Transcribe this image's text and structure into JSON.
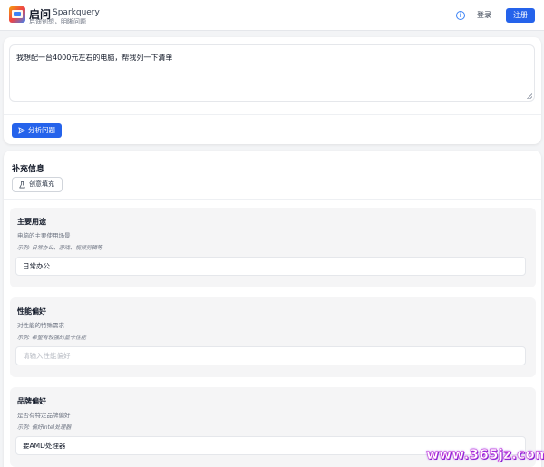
{
  "header": {
    "app_name": "启问",
    "app_name_en": "Sparkquery",
    "tagline": "启迪创想，明晰问题",
    "info_icon": "info-circle-icon",
    "login_label": "登录",
    "signup_label": "注册"
  },
  "question": {
    "value": "我想配一台4000元左右的电脑，帮我列一下清单",
    "analyze_label": "分析问题"
  },
  "supplement": {
    "title": "补充信息",
    "fill_label": "创意填充",
    "fields": [
      {
        "title": "主要用途",
        "description": "电脑的主要使用场景",
        "example": "示例: 日常办公、游戏、视频剪辑等",
        "value": "日常办公",
        "placeholder": ""
      },
      {
        "title": "性能偏好",
        "description": "对性能的特殊需求",
        "example": "示例: 希望有较强的显卡性能",
        "value": "",
        "placeholder": "请输入性能偏好"
      },
      {
        "title": "品牌偏好",
        "description": "是否有特定品牌偏好",
        "example": "示例: 偏好Intel处理器",
        "value": "要AMD处理器",
        "placeholder": ""
      }
    ]
  },
  "watermark": "www.365jz.com",
  "colors": {
    "primary": "#2563eb",
    "background": "#f3f4f6",
    "field_background": "#f5f5f6"
  }
}
